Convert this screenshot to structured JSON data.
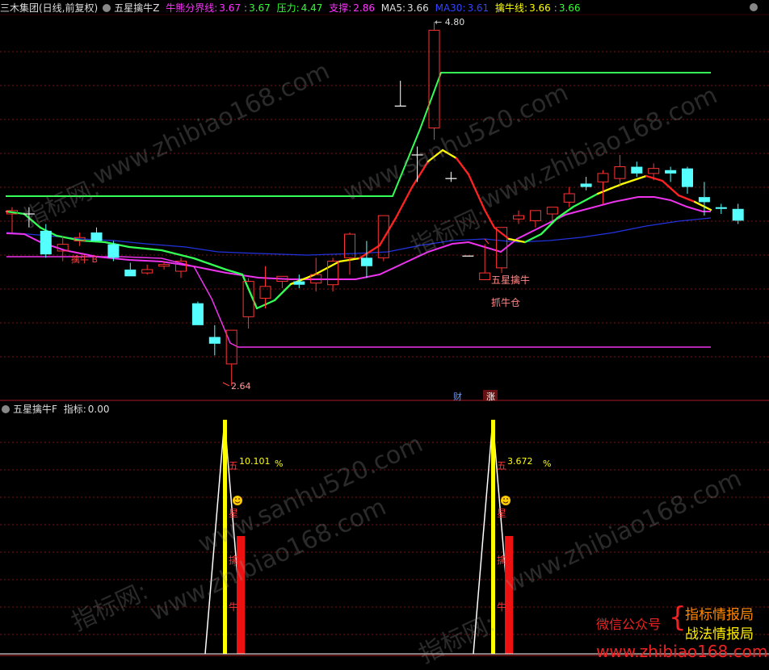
{
  "header_top": {
    "title": "三木集团(日线,前复权)",
    "indicator": "五星擒牛Z",
    "items": [
      {
        "label": "牛熊分界线:",
        "value1": "3.67",
        "value2": "3.67",
        "color": "#ff33ff",
        "color2": "#33ff33"
      },
      {
        "label": "压力:",
        "value1": "4.47",
        "color": "#33ff33"
      },
      {
        "label": "支撑:",
        "value1": "2.86",
        "color": "#ff33ff"
      },
      {
        "label": "MA5:",
        "value1": "3.66",
        "color": "#dddddd"
      },
      {
        "label": "MA30:",
        "value1": "3.61",
        "color": "#3344ff"
      },
      {
        "label": "擒牛线:",
        "value1": "3.66",
        "value2": "3.66",
        "color": "#ffff00",
        "color2": "#33ff33"
      }
    ]
  },
  "header_bottom": {
    "indicator": "五星擒牛F",
    "label": "指标:",
    "value": "0.00"
  },
  "annotations": {
    "high": "4.80",
    "low": "2.64",
    "qin_niu": "擒牛 B",
    "wu_xing": "五星擒牛",
    "zhua_niu": "抓牛仓",
    "cai": "财",
    "zhang": "涨",
    "pct1": "10.101",
    "pct2": "3.672",
    "pct_sign": "%",
    "col_chars": [
      "五",
      "星",
      "擒",
      "牛"
    ]
  },
  "watermarks": [
    "www.zhibiao168.com",
    "www.sanhu520.com",
    "指标网:"
  ],
  "promo": {
    "wechat": "微信公众号",
    "line1": "指标情报局",
    "line2": "战法情报局",
    "url": "www.zhibiao168.com"
  },
  "colors": {
    "up": "#ff3333",
    "down": "#55ffff",
    "ma30": "#2233dd",
    "magenta": "#ee33ee",
    "green_line": "#33ff55",
    "yellow": "#ffff00"
  },
  "chart_data": {
    "type": "candlestick",
    "price_range": [
      2.64,
      4.8
    ],
    "candles": [
      {
        "o": 3.66,
        "h": 3.7,
        "l": 3.55,
        "c": 3.68
      },
      {
        "o": 3.66,
        "h": 3.7,
        "l": 3.58,
        "c": 3.66
      },
      {
        "o": 3.56,
        "h": 3.6,
        "l": 3.4,
        "c": 3.42
      },
      {
        "o": 3.44,
        "h": 3.53,
        "l": 3.38,
        "c": 3.48
      },
      {
        "o": 3.5,
        "h": 3.55,
        "l": 3.47,
        "c": 3.52
      },
      {
        "o": 3.55,
        "h": 3.58,
        "l": 3.5,
        "c": 3.5
      },
      {
        "o": 3.48,
        "h": 3.5,
        "l": 3.38,
        "c": 3.4
      },
      {
        "o": 3.33,
        "h": 3.37,
        "l": 3.29,
        "c": 3.29
      },
      {
        "o": 3.31,
        "h": 3.36,
        "l": 3.3,
        "c": 3.33
      },
      {
        "o": 3.35,
        "h": 3.38,
        "l": 3.33,
        "c": 3.36
      },
      {
        "o": 3.32,
        "h": 3.4,
        "l": 3.28,
        "c": 3.38
      },
      {
        "o": 3.13,
        "h": 3.14,
        "l": 3.0,
        "c": 3.0
      },
      {
        "o": 2.93,
        "h": 3.0,
        "l": 2.82,
        "c": 2.89
      },
      {
        "o": 2.77,
        "h": 2.97,
        "l": 2.64,
        "c": 2.97
      },
      {
        "o": 3.05,
        "h": 3.28,
        "l": 2.98,
        "c": 3.26
      },
      {
        "o": 3.16,
        "h": 3.35,
        "l": 3.1,
        "c": 3.23
      },
      {
        "o": 3.26,
        "h": 3.29,
        "l": 3.22,
        "c": 3.29
      },
      {
        "o": 3.26,
        "h": 3.3,
        "l": 3.22,
        "c": 3.24
      },
      {
        "o": 3.25,
        "h": 3.4,
        "l": 3.2,
        "c": 3.3
      },
      {
        "o": 3.24,
        "h": 3.4,
        "l": 3.2,
        "c": 3.38
      },
      {
        "o": 3.4,
        "h": 3.55,
        "l": 3.3,
        "c": 3.54
      },
      {
        "o": 3.4,
        "h": 3.5,
        "l": 3.28,
        "c": 3.35
      },
      {
        "o": 3.4,
        "h": 3.65,
        "l": 3.38,
        "c": 3.65
      },
      {
        "o": 4.3,
        "h": 4.45,
        "l": 4.3,
        "c": 4.3
      },
      {
        "o": 4.01,
        "h": 4.06,
        "l": 3.85,
        "c": 4.01
      },
      {
        "o": 4.17,
        "h": 4.8,
        "l": 4.1,
        "c": 4.75
      },
      {
        "o": 3.87,
        "h": 3.91,
        "l": 3.85,
        "c": 3.87
      },
      {
        "o": 3.41,
        "h": 3.41,
        "l": 3.41,
        "c": 3.41
      },
      {
        "o": 3.27,
        "h": 3.48,
        "l": 3.27,
        "c": 3.31
      },
      {
        "o": 3.34,
        "h": 3.58,
        "l": 3.31,
        "c": 3.58
      },
      {
        "o": 3.63,
        "h": 3.68,
        "l": 3.6,
        "c": 3.65
      },
      {
        "o": 3.62,
        "h": 3.68,
        "l": 3.58,
        "c": 3.68
      },
      {
        "o": 3.66,
        "h": 3.7,
        "l": 3.62,
        "c": 3.7
      },
      {
        "o": 3.73,
        "h": 3.82,
        "l": 3.7,
        "c": 3.78
      },
      {
        "o": 3.84,
        "h": 3.88,
        "l": 3.8,
        "c": 3.82
      },
      {
        "o": 3.85,
        "h": 3.92,
        "l": 3.72,
        "c": 3.9
      },
      {
        "o": 3.87,
        "h": 4.01,
        "l": 3.83,
        "c": 3.94
      },
      {
        "o": 3.94,
        "h": 3.97,
        "l": 3.88,
        "c": 3.9
      },
      {
        "o": 3.9,
        "h": 3.96,
        "l": 3.86,
        "c": 3.93
      },
      {
        "o": 3.92,
        "h": 3.94,
        "l": 3.85,
        "c": 3.9
      },
      {
        "o": 3.93,
        "h": 3.94,
        "l": 3.78,
        "c": 3.82
      },
      {
        "o": 3.76,
        "h": 3.85,
        "l": 3.65,
        "c": 3.73
      },
      {
        "o": 3.7,
        "h": 3.72,
        "l": 3.66,
        "c": 3.69
      },
      {
        "o": 3.69,
        "h": 3.72,
        "l": 3.6,
        "c": 3.62
      }
    ],
    "indicator_panel": {
      "value": 0.0,
      "spikes": [
        {
          "index": 13,
          "pct": 10.101
        },
        {
          "index": 29,
          "pct": 3.672
        }
      ]
    }
  }
}
